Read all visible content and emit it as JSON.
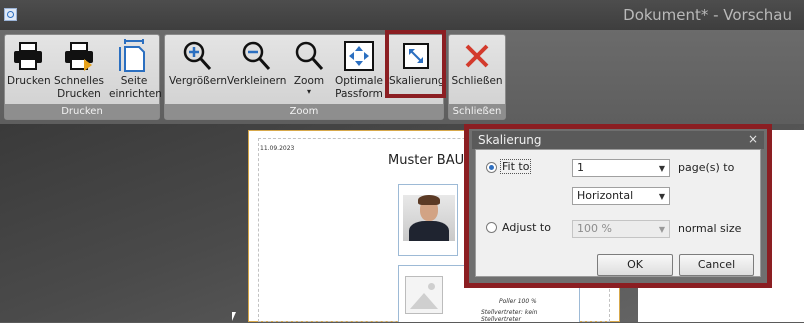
{
  "window": {
    "title": "Dokument* - Vorschau"
  },
  "ribbon": {
    "groups": {
      "drucken": "Drucken",
      "zoom": "Zoom",
      "schliessen": "Schließen"
    },
    "buttons": {
      "drucken": "Drucken",
      "schnelles_drucken": "Schnelles\nDrucken",
      "seite_einrichten": "Seite\neinrichten",
      "vergroessern": "Vergrößern",
      "verkleinern": "Verkleinern",
      "zoom": "Zoom",
      "zoom_arrow": "▾",
      "optimale_passform": "Optimale\nPassform",
      "skalierung": "Skalierung",
      "schliessen": "Schließen"
    }
  },
  "preview": {
    "date": "11.09.2023",
    "title": "Muster BAU A",
    "info_line1": "Poller  100 %",
    "info_line2": "Stellvertreter: kein Stellvertreter"
  },
  "dialog": {
    "title": "Skalierung",
    "close": "×",
    "fit_to_label": "Fit to",
    "fit_to_selected": true,
    "pages_value": "1",
    "pages_suffix": "page(s) to",
    "direction_value": "Horizontal",
    "adjust_to_label": "Adjust to",
    "adjust_to_selected": false,
    "percent_value": "100 %",
    "percent_suffix": "normal size",
    "ok_label": "OK",
    "cancel_label": "Cancel"
  },
  "icons": [
    "printer-icon",
    "quick-print-icon",
    "page-setup-icon",
    "zoom-in-icon",
    "zoom-out-icon",
    "zoom-icon",
    "fit-optimal-icon",
    "scaling-icon",
    "close-x-icon"
  ],
  "colors": {
    "highlight": "#8b1e22",
    "accent_blue": "#2b6fc0",
    "close_red": "#d33a2c"
  }
}
